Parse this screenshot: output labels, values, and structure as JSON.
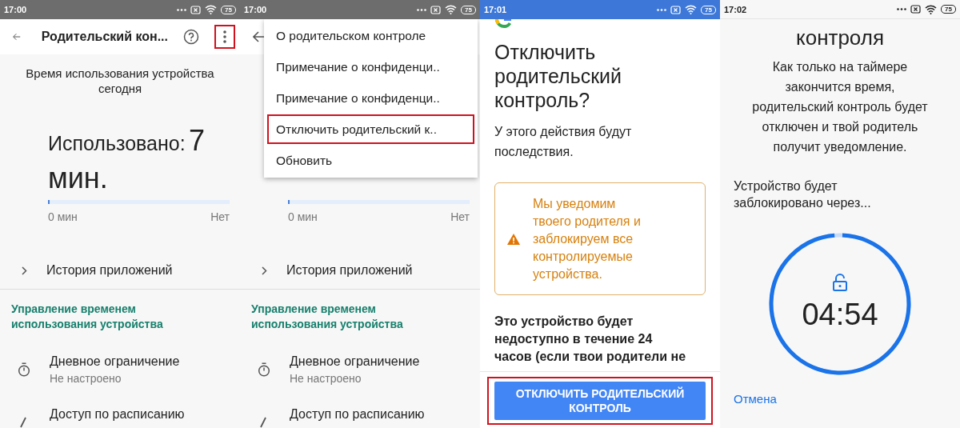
{
  "screens": [
    {
      "kind": "overview",
      "status_bar": {
        "time": "17:00",
        "battery": "75"
      },
      "app_bar": {
        "title": "Родительский кон...",
        "actions": [
          {
            "kind": "help",
            "highlighted": false
          },
          {
            "kind": "more",
            "highlighted": true
          }
        ]
      },
      "usage_heading": "Время использования устройства сегодня",
      "usage": {
        "label": "Использовано:",
        "value": "7 мин."
      },
      "progress": {
        "level": 0.01,
        "start_label": "0 мин",
        "end_label": "Нет"
      },
      "history_link": "История приложений",
      "section_heading": "Управление временем использования устройства",
      "items": [
        {
          "title": "Дневное ограничение",
          "subtitle": "Не настроено"
        },
        {
          "title": "Доступ по расписанию"
        }
      ]
    },
    {
      "kind": "overview",
      "status_bar": {
        "time": "17:00",
        "battery": "75"
      },
      "progress": {
        "level": 0.01,
        "start_label": "0 мин",
        "end_label": "Нет"
      },
      "history_link": "История приложений",
      "section_heading": "Управление временем использования устройства",
      "items": [
        {
          "title": "Дневное ограничение",
          "subtitle": "Не настроено"
        },
        {
          "title": "Доступ по расписанию"
        }
      ],
      "menu": [
        {
          "label": "О родительском контроле",
          "highlighted": false
        },
        {
          "label": "Примечание о конфиденци..",
          "highlighted": false
        },
        {
          "label": "Примечание о конфиденци..",
          "highlighted": false
        },
        {
          "label": "Отключить родительский к..",
          "highlighted": true
        },
        {
          "label": "Обновить",
          "highlighted": false
        }
      ]
    },
    {
      "kind": "confirm",
      "status_bar": {
        "time": "17:01",
        "battery": "75"
      },
      "title": "Отключить родительский контроль?",
      "subtitle": "У этого действия будут последствия.",
      "warning": "Мы уведомим твоего родителя и заблокируем все контролируемые устройства.",
      "body": "Это устройство будет недоступно в течение 24 часов (если твои родители не",
      "button": {
        "label": "ОТКЛЮЧИТЬ РОДИТЕЛЬСКИЙ КОНТРОЛЬ",
        "highlighted": true
      }
    },
    {
      "kind": "countdown",
      "status_bar": {
        "time": "17:02",
        "battery": "75"
      },
      "title": "контроля",
      "message": "Как только на таймере закончится время, родительский контроль будет отключен и твой родитель получит уведомление.",
      "lock_label": "Устройство будет заблокировано через...",
      "timer": {
        "value": "04:54",
        "level": 0.98
      },
      "cancel": "Отмена"
    }
  ]
}
